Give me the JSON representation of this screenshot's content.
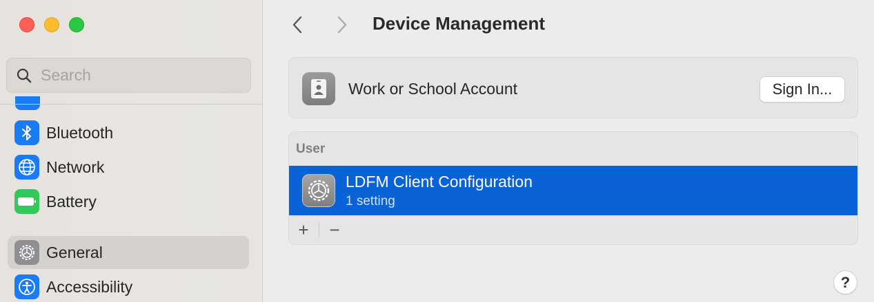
{
  "window": {
    "controls": [
      "close",
      "minimize",
      "zoom"
    ]
  },
  "sidebar": {
    "search": {
      "placeholder": "Search",
      "value": "",
      "icon": "search-icon"
    },
    "items": [
      {
        "label": "Bluetooth",
        "icon": "bluetooth-icon",
        "color": "#1a7bf5",
        "selected": false
      },
      {
        "label": "Network",
        "icon": "network-globe-icon",
        "color": "#1a7bf5",
        "selected": false
      },
      {
        "label": "Battery",
        "icon": "battery-icon",
        "color": "#34c759",
        "selected": false
      },
      {
        "label": "General",
        "icon": "gear-icon",
        "color": "#8e8e93",
        "selected": true
      },
      {
        "label": "Accessibility",
        "icon": "accessibility-icon",
        "color": "#1a7bf5",
        "selected": false
      }
    ]
  },
  "toolbar": {
    "back_icon": "chevron-left-icon",
    "forward_icon": "chevron-right-icon",
    "title": "Device Management"
  },
  "account_card": {
    "icon": "id-badge-icon",
    "label": "Work or School Account",
    "button_label": "Sign In..."
  },
  "profiles": {
    "section_label": "User",
    "items": [
      {
        "title": "LDFM Client Configuration",
        "subtitle": "1 setting",
        "icon": "gear-icon",
        "selected": true
      }
    ],
    "add_label": "+",
    "remove_label": "−"
  },
  "help": {
    "label": "?"
  },
  "colors": {
    "accent": "#0a63d6",
    "sidebar_bg": "#e8e5e1",
    "main_bg": "#ececec"
  }
}
